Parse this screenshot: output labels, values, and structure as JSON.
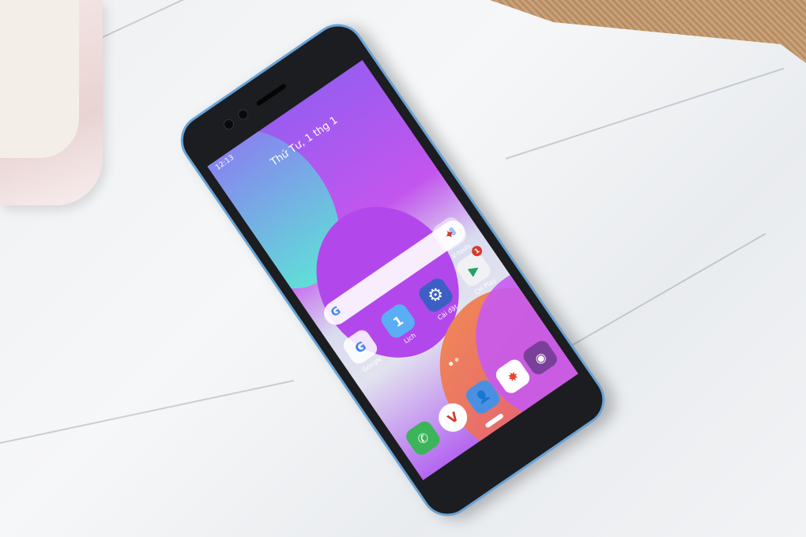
{
  "status_bar": {
    "time": "12:13"
  },
  "lock_date": "Thứ Tư, 1 thg 1",
  "search": {
    "logo": "G"
  },
  "apps": [
    {
      "label": "Google",
      "icon": "google-folder-icon",
      "glyph": "G"
    },
    {
      "label": "Lịch",
      "icon": "calendar-icon",
      "glyph": "1"
    },
    {
      "label": "Cài đặt",
      "icon": "settings-gear-icon",
      "glyph": "⚙"
    },
    {
      "label": "CH Play",
      "icon": "play-store-icon",
      "glyph": "▶",
      "badge": "1"
    },
    {
      "label": "V-tools",
      "icon": "vtools-folder-icon",
      "glyph": "✦"
    }
  ],
  "dock": [
    {
      "icon": "phone-icon",
      "glyph": "✆"
    },
    {
      "icon": "vmessage-icon",
      "glyph": "V"
    },
    {
      "icon": "contacts-icon",
      "glyph": "👤"
    },
    {
      "icon": "photos-icon",
      "glyph": "✸"
    },
    {
      "icon": "camera-icon",
      "glyph": "◉"
    }
  ],
  "colors": {
    "phone_frame": "#6aa4d8",
    "accent": "#c356ee"
  }
}
